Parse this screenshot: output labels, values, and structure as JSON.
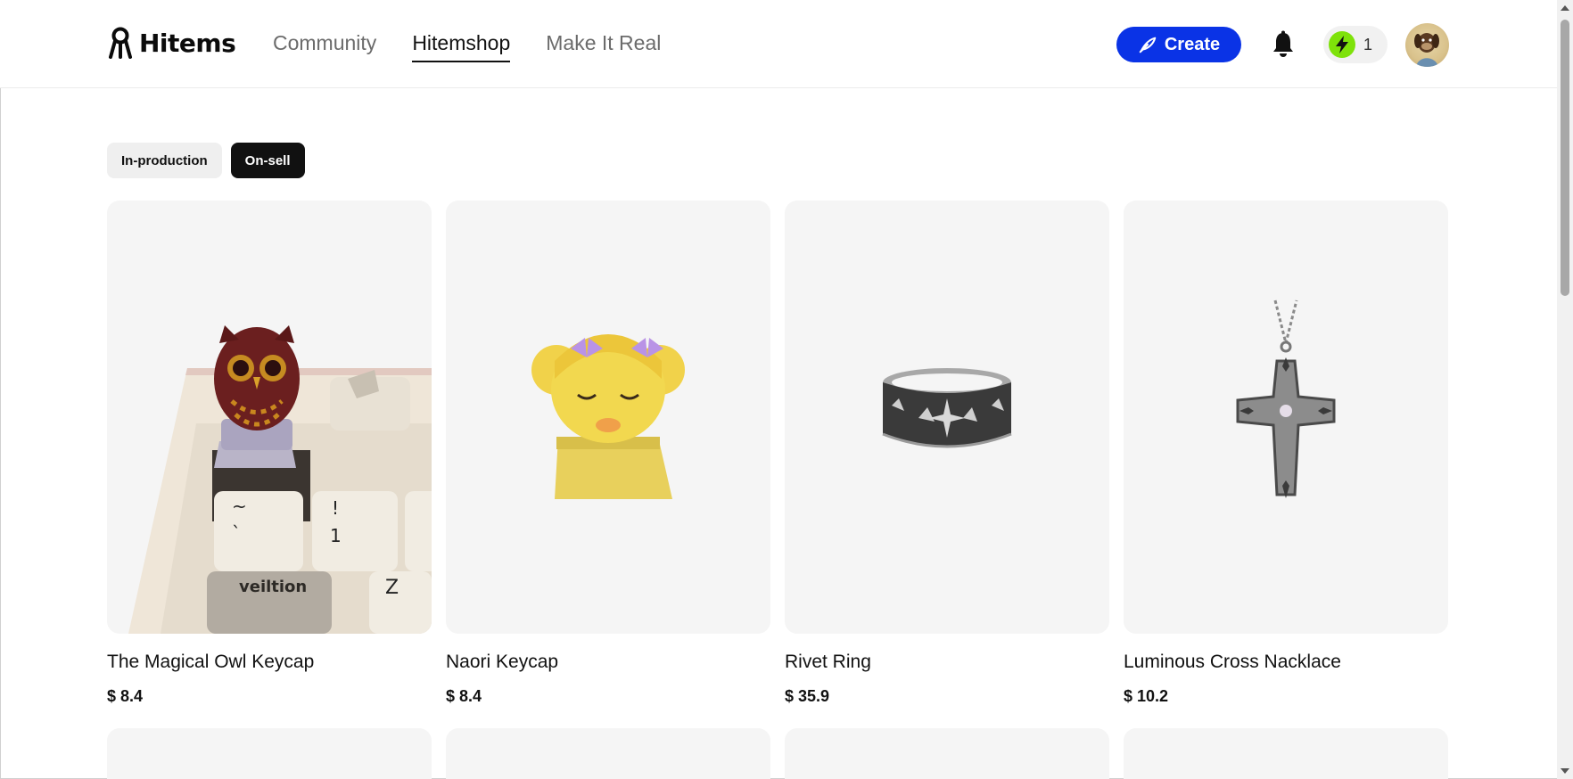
{
  "brand": {
    "name": "Hitems"
  },
  "nav": [
    {
      "label": "Community",
      "active": false
    },
    {
      "label": "Hitemshop",
      "active": true
    },
    {
      "label": "Make It Real",
      "active": false
    }
  ],
  "header": {
    "create_label": "Create",
    "energy_count": "1",
    "accent_color": "#0a33e6",
    "energy_color": "#7ee20a"
  },
  "filters": [
    {
      "label": "In-production",
      "active": false
    },
    {
      "label": "On-sell",
      "active": true
    }
  ],
  "products": [
    {
      "title": "The Magical Owl Keycap",
      "price": "$ 8.4",
      "image": "owl-keycap-image"
    },
    {
      "title": "Naori Keycap",
      "price": "$ 8.4",
      "image": "naori-keycap-image"
    },
    {
      "title": "Rivet Ring",
      "price": "$ 35.9",
      "image": "rivet-ring-image"
    },
    {
      "title": "Luminous Cross Nacklace",
      "price": "$ 10.2",
      "image": "cross-necklace-image"
    }
  ],
  "keyboard_legends": [
    "~",
    "`",
    "!",
    "1",
    "veiltion",
    "Z"
  ]
}
